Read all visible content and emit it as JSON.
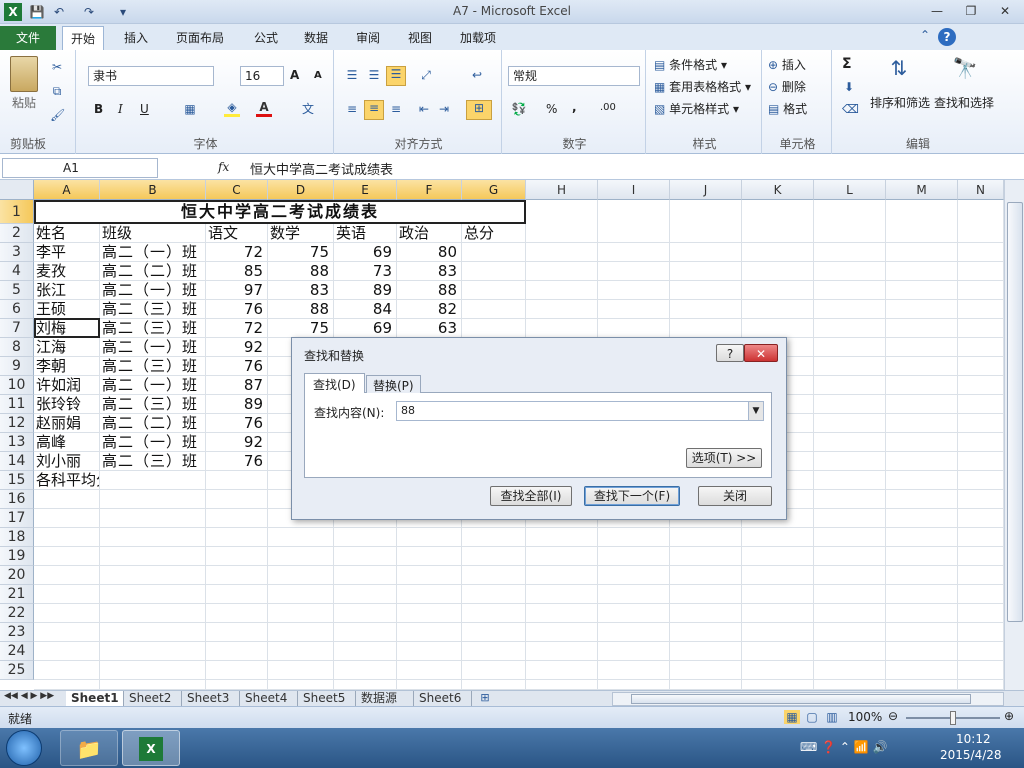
{
  "window": {
    "title": "A7 - Microsoft Excel"
  },
  "ribbon_tabs": [
    "文件",
    "开始",
    "插入",
    "页面布局",
    "公式",
    "数据",
    "审阅",
    "视图",
    "加载项"
  ],
  "ribbon": {
    "clipboard": {
      "paste": "粘贴",
      "label": "剪贴板"
    },
    "font": {
      "name": "隶书",
      "size": "16",
      "bold": "B",
      "italic": "I",
      "underline": "U",
      "label": "字体"
    },
    "alignment": {
      "label": "对齐方式"
    },
    "number": {
      "format": "常规",
      "percent": "%",
      "comma": ",",
      "inc": ".00",
      "label": "数字"
    },
    "styles": {
      "cond": "条件格式",
      "table": "套用表格格式",
      "cell": "单元格样式",
      "label": "样式"
    },
    "cells": {
      "insert": "插入",
      "delete": "删除",
      "format": "格式",
      "label": "单元格"
    },
    "editing": {
      "sum": "Σ",
      "sort": "排序和筛选",
      "find": "查找和选择",
      "label": "编辑"
    }
  },
  "formula_bar": {
    "name_box": "A1",
    "fx": "fx",
    "content": "恒大中学高二考试成绩表"
  },
  "columns": [
    "A",
    "B",
    "C",
    "D",
    "E",
    "F",
    "G",
    "H",
    "I",
    "J",
    "K",
    "L",
    "M",
    "N"
  ],
  "rows": [
    "1",
    "2",
    "3",
    "4",
    "5",
    "6",
    "7",
    "8",
    "9",
    "10",
    "11",
    "12",
    "13",
    "14",
    "15",
    "16",
    "17",
    "18",
    "19",
    "20",
    "21",
    "22",
    "23",
    "24",
    "25"
  ],
  "sheet_title": "恒大中学高二考试成绩表",
  "headers": [
    "姓名",
    "班级",
    "语文",
    "数学",
    "英语",
    "政治",
    "总分"
  ],
  "students": [
    {
      "name": "李平",
      "cls": "高二（一）班",
      "c": "72",
      "d": "75",
      "e": "69",
      "f": "80"
    },
    {
      "name": "麦孜",
      "cls": "高二（二）班",
      "c": "85",
      "d": "88",
      "e": "73",
      "f": "83"
    },
    {
      "name": "张江",
      "cls": "高二（一）班",
      "c": "97",
      "d": "83",
      "e": "89",
      "f": "88"
    },
    {
      "name": "王硕",
      "cls": "高二（三）班",
      "c": "76",
      "d": "88",
      "e": "84",
      "f": "82"
    },
    {
      "name": "刘梅",
      "cls": "高二（三）班",
      "c": "72",
      "d": "75",
      "e": "69",
      "f": "63"
    },
    {
      "name": "江海",
      "cls": "高二（一）班",
      "c": "92",
      "d": "",
      "e": "",
      "f": ""
    },
    {
      "name": "李朝",
      "cls": "高二（三）班",
      "c": "76",
      "d": "",
      "e": "",
      "f": ""
    },
    {
      "name": "许如润",
      "cls": "高二（一）班",
      "c": "87",
      "d": "",
      "e": "",
      "f": ""
    },
    {
      "name": "张玲铃",
      "cls": "高二（三）班",
      "c": "89",
      "d": "",
      "e": "",
      "f": ""
    },
    {
      "name": "赵丽娟",
      "cls": "高二（二）班",
      "c": "76",
      "d": "",
      "e": "",
      "f": ""
    },
    {
      "name": "高峰",
      "cls": "高二（一）班",
      "c": "92",
      "d": "",
      "e": "",
      "f": ""
    },
    {
      "name": "刘小丽",
      "cls": "高二（三）班",
      "c": "76",
      "d": "",
      "e": "",
      "f": ""
    }
  ],
  "avg_label": "各科平均分",
  "dialog": {
    "title": "查找和替换",
    "help": "?",
    "close": "✕",
    "tab_find": "查找(D)",
    "tab_replace": "替换(P)",
    "find_label": "查找内容(N):",
    "find_value": "88",
    "options": "选项(T) >>",
    "find_all": "查找全部(I)",
    "find_next": "查找下一个(F)",
    "close_btn": "关闭"
  },
  "sheets": [
    "Sheet1",
    "Sheet2",
    "Sheet3",
    "Sheet4",
    "Sheet5",
    "数据源",
    "Sheet6"
  ],
  "status": {
    "ready": "就绪",
    "zoom": "100%"
  },
  "taskbar": {
    "time": "10:12",
    "date": "2015/4/28"
  }
}
